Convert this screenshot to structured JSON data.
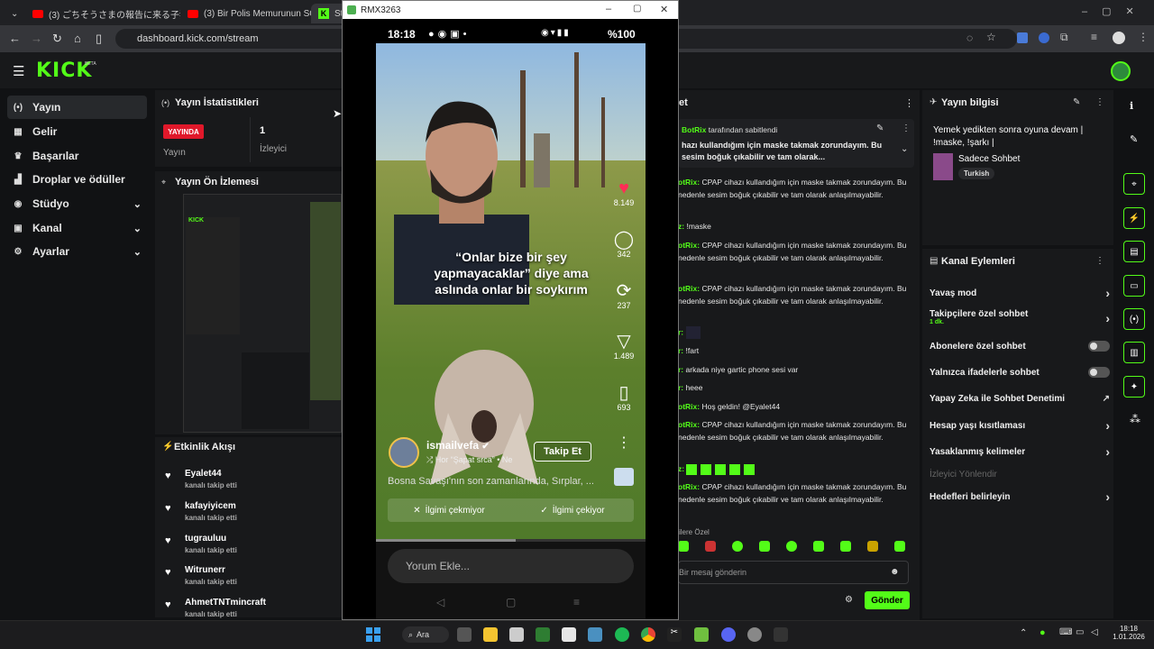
{
  "browser": {
    "tabs": [
      {
        "title": "(3) ごちそうさまの報告に来る子猫 | ..."
      },
      {
        "title": "(3) Bir Polis Memurunun SON A..."
      },
      {
        "title": "Stre..."
      }
    ],
    "url": "dashboard.kick.com/stream"
  },
  "kick": {
    "logo": "KICK",
    "beta": "BETA"
  },
  "sidebar": {
    "items": [
      {
        "label": "Yayın",
        "icon": "broadcast-icon"
      },
      {
        "label": "Gelir",
        "icon": "revenue-icon"
      },
      {
        "label": "Başarılar",
        "icon": "trophy-icon"
      },
      {
        "label": "Droplar ve ödüller",
        "icon": "drops-icon"
      },
      {
        "label": "Stüdyo",
        "icon": "studio-icon"
      },
      {
        "label": "Kanal",
        "icon": "channel-icon"
      },
      {
        "label": "Ayarlar",
        "icon": "gear-icon"
      }
    ]
  },
  "stats": {
    "title": "Yayın İstatistikleri",
    "live_badge": "YAYINDA",
    "stream_label": "Yayın",
    "viewer_count": "1",
    "viewer_label": "İzleyici"
  },
  "preview": {
    "title": "Yayın Ön İzlemesi"
  },
  "activity": {
    "title": "Etkinlik Akışı",
    "events": [
      {
        "name": "Eyalet44",
        "action": "kanalı takip etti"
      },
      {
        "name": "kafayiyicem",
        "action": "kanalı takip etti"
      },
      {
        "name": "tugrauluu",
        "action": "kanalı takip etti"
      },
      {
        "name": "Witrunerr",
        "action": "kanalı takip etti"
      },
      {
        "name": "AhmetTNTmincraft",
        "action": "kanalı takip etti"
      }
    ]
  },
  "phone": {
    "window_title": "RMX3263",
    "status_time": "18:18",
    "battery": "%100",
    "caption": "“Onlar bize bir şey yapmayacaklar” diye ama aslında onlar bir soykırım",
    "likes": "8.149",
    "comments": "342",
    "reposts": "237",
    "shares": "1.489",
    "saves": "693",
    "username": "ismailvefa",
    "sound": "Hor “Şapat srca” • Ne",
    "follow_label": "Takip Et",
    "description": "Bosna Savaşı'nın son zamanlarında, Sırplar, ...",
    "not_interested": "İlgimi çekmiyor",
    "interested": "İlgimi çekiyor",
    "comment_placeholder": "Yorum Ekle..."
  },
  "chat": {
    "title_fragment": "et",
    "pinned_by": "BotRix",
    "pinned_suffix": "tarafından sabitlendi",
    "pinned_text": "hazı kullandığım için maske takmak zorundayım. Bu sesim boğuk çıkabilir ve tam olarak...",
    "messages": [
      {
        "user": "otRix:",
        "text": "CPAP cihazı kullandığım için maske takmak zorundayım. Bu nedenle sesim boğuk çıkabilir ve tam olarak anlaşılmayabilir."
      },
      {
        "user": "z:",
        "text": "!maske"
      },
      {
        "user": "otRix:",
        "text": "CPAP cihazı kullandığım için maske takmak zorundayım. Bu nedenle sesim boğuk çıkabilir ve tam olarak anlaşılmayabilir."
      },
      {
        "user": "otRix:",
        "text": "CPAP cihazı kullandığım için maske takmak zorundayım. Bu nedenle sesim boğuk çıkabilir ve tam olarak anlaşılmayabilir."
      },
      {
        "user": "r:",
        "text": ""
      },
      {
        "user": "r:",
        "text": "!fart"
      },
      {
        "user": "r:",
        "text": "arkada niye gartic phone sesi var"
      },
      {
        "user": "r:",
        "text": "heee"
      },
      {
        "user": "otRix:",
        "text": "Hoş geldin! @Eyalet44"
      },
      {
        "user": "otRix:",
        "text": "CPAP cihazı kullandığım için maske takmak zorundayım. Bu nedenle sesim boğuk çıkabilir ve tam olarak anlaşılmayabilir."
      },
      {
        "user": "z:",
        "text": ""
      },
      {
        "user": "otRix:",
        "text": "CPAP cihazı kullandığım için maske takmak zorundayım. Bu nedenle sesim boğuk çıkabilir ve tam olarak anlaşılmayabilir."
      }
    ],
    "emote_section": "ilere Özel",
    "input_placeholder": "Bir mesaj gönderin",
    "send_label": "Gönder"
  },
  "stream_info": {
    "title": "Yayın bilgisi",
    "stream_title": "Yemek yedikten sonra oyuna devam | !maske, !şarkı |",
    "category": "Sadece Sohbet",
    "language": "Turkish"
  },
  "channel_actions": {
    "title": "Kanal Eylemleri",
    "items": [
      {
        "label": "Yavaş mod",
        "sub": ""
      },
      {
        "label": "Takipçilere özel sohbet",
        "sub": "1 dk."
      },
      {
        "label": "Abonelere özel sohbet",
        "sub": ""
      },
      {
        "label": "Yalnızca ifadelerle sohbet",
        "sub": ""
      },
      {
        "label": "Yapay Zeka ile Sohbet Denetimi",
        "sub": ""
      },
      {
        "label": "Hesap yaşı kısıtlaması",
        "sub": ""
      },
      {
        "label": "Yasaklanmış kelimeler",
        "sub": ""
      },
      {
        "label": "İzleyici Yönlendir",
        "sub": ""
      },
      {
        "label": "Hedefleri belirleyin",
        "sub": ""
      }
    ]
  },
  "taskbar": {
    "search_label": "Ara",
    "time": "18:18",
    "date": "1.01.2026"
  },
  "colors": {
    "accent": "#53fc18",
    "live": "#e0182a",
    "panel": "#18191b"
  }
}
